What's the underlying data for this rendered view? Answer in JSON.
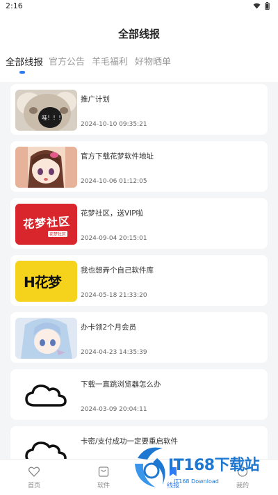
{
  "status_bar": {
    "time": "2:16"
  },
  "header": {
    "title": "全部线报"
  },
  "tabs": [
    {
      "label": "全部线报",
      "active": true
    },
    {
      "label": "官方公告",
      "active": false
    },
    {
      "label": "羊毛福利",
      "active": false
    },
    {
      "label": "好物晒单",
      "active": false
    }
  ],
  "posts": [
    {
      "title": "推广计划",
      "date": "2024-10-10 09:35:21",
      "thumb_text": "哇！！！"
    },
    {
      "title": "官方下载花梦软件地址",
      "date": "2024-10-06 01:12:05"
    },
    {
      "title": "花梦社区，送VIP啦",
      "date": "2024-09-04 20:15:01",
      "thumb_text": "花梦社区",
      "thumb_sub": "花梦社区"
    },
    {
      "title": "我也想弄个自己软件库",
      "date": "2024-05-18 21:33:20",
      "thumb_text": "H花梦"
    },
    {
      "title": "办卡领2个月会员",
      "date": "2024-04-23 14:35:39"
    },
    {
      "title": "下载一直跳浏览器怎么办",
      "date": "2024-03-09 20:04:11"
    },
    {
      "title": "卡密/支付成功一定要重启软件",
      "date": ""
    }
  ],
  "bottom_nav": [
    {
      "label": "首页",
      "icon": "heart-icon"
    },
    {
      "label": "软件",
      "icon": "bag-icon"
    },
    {
      "label": "线报",
      "icon": "bookmark-icon"
    },
    {
      "label": "我的",
      "icon": "user-icon"
    }
  ],
  "watermark": {
    "text": "IT168下载站",
    "sub": "IT168 Download"
  },
  "colors": {
    "accent": "#2f7cf6",
    "background": "#f4f5f7",
    "watermark": "#1e78d2"
  }
}
